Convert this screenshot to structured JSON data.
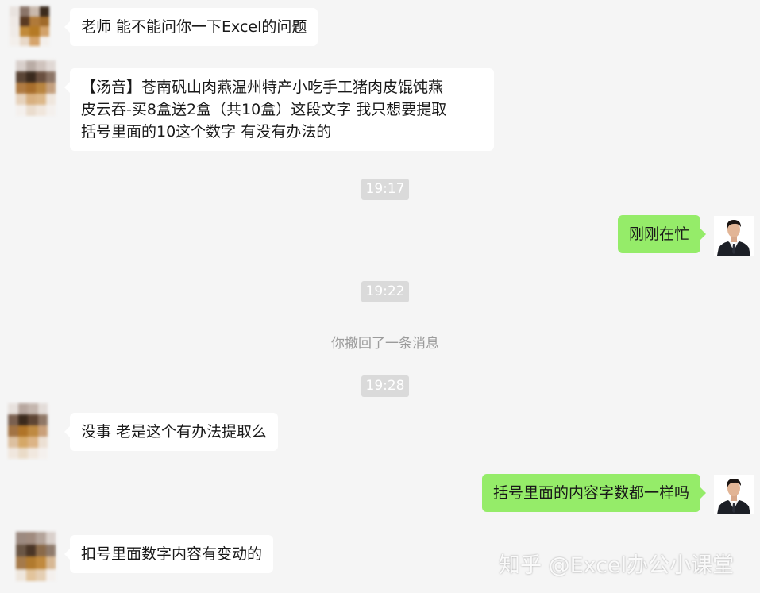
{
  "messages": [
    {
      "sender": "other",
      "text": "老师 能不能问你一下Excel的问题"
    },
    {
      "sender": "other",
      "lines": [
        "【汤音】苍南矾山肉燕温州特产小吃手工猪肉皮馄饨燕",
        "皮云吞-买8盒送2盒（共10盒）这段文字 我只想要提取",
        "括号里面的10这个数字 有没有办法的"
      ]
    },
    {
      "sender": "me",
      "text": "刚刚在忙"
    },
    {
      "sender": "other",
      "text": "没事 老是这个有办法提取么"
    },
    {
      "sender": "me",
      "text": "括号里面的内容字数都一样吗"
    },
    {
      "sender": "other",
      "text": "扣号里面数字内容有变动的"
    }
  ],
  "timestamps": [
    "19:17",
    "19:22",
    "19:28"
  ],
  "system_notice": "你撤回了一条消息",
  "watermark": "知乎 @Excel办公小课堂",
  "colors": {
    "background": "#f5f5f5",
    "incoming_bubble": "#ffffff",
    "outgoing_bubble": "#95ec69",
    "time_chip": "#dadada"
  }
}
